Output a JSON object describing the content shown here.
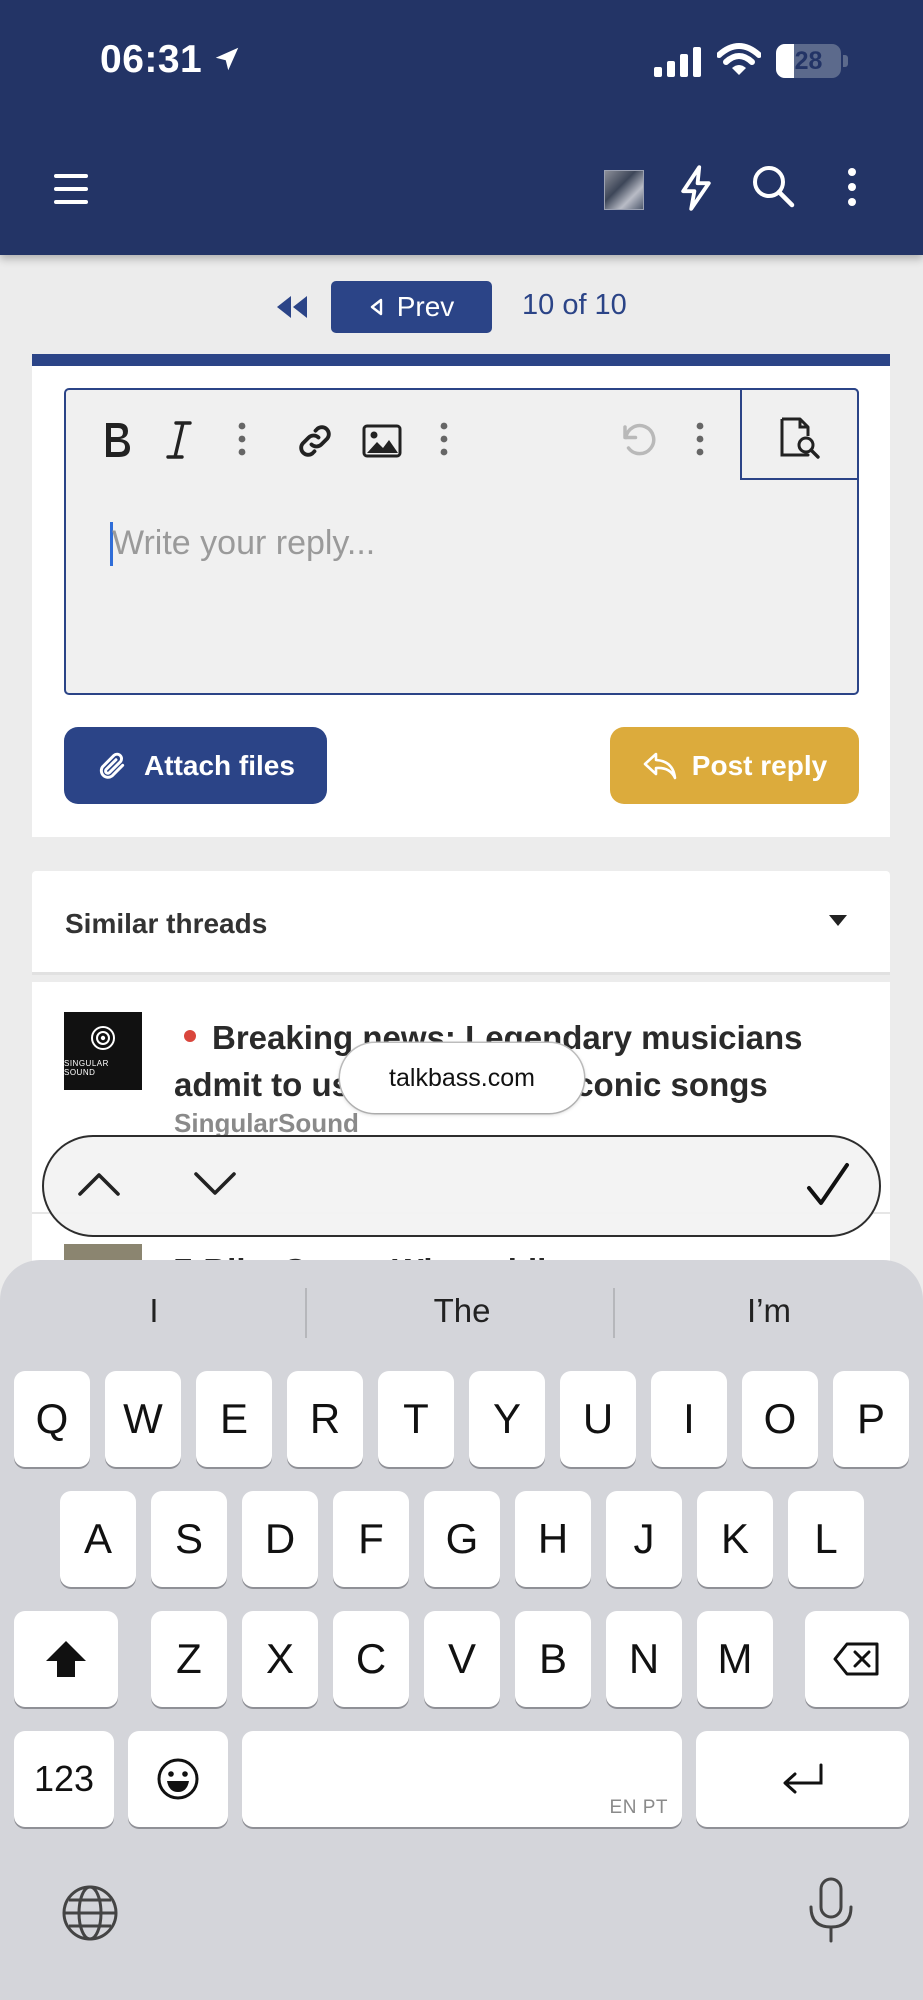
{
  "status_bar": {
    "time": "06:31",
    "battery": "28",
    "battery_level": 0.28,
    "icons": [
      "location-arrow-icon",
      "signal-bars-icon",
      "wifi-icon",
      "battery-icon"
    ]
  },
  "header": {
    "icons": [
      "hamburger-menu-icon",
      "avatar",
      "bolt-icon",
      "search-icon",
      "more-vertical-icon"
    ]
  },
  "pagination": {
    "first_icon": "double-chevron-left-icon",
    "prev_label": "Prev",
    "page_info": "10 of 10"
  },
  "editor": {
    "toolbar": [
      "bold-icon",
      "italic-icon",
      "more-vertical-icon",
      "link-icon",
      "image-icon",
      "more-vertical-icon",
      "undo-icon",
      "more-vertical-icon",
      "preview-icon"
    ],
    "placeholder": "Write your reply...",
    "value": ""
  },
  "actions": {
    "attach_label": "Attach files",
    "post_label": "Post reply"
  },
  "similar_threads": {
    "title": "Similar threads",
    "items": [
      {
        "title": "Breaking news: Legendary musicians admit to us",
        "title_tail": "y in iconic songs",
        "author": "SingularSound",
        "logo_text": "SINGULAR SOUND"
      },
      {
        "title": "7-Bike Gear... Why ... bike ...",
        "author": ""
      }
    ]
  },
  "url_pill": "talkbass.com",
  "accessory": {
    "icons": [
      "chevron-up-icon",
      "chevron-down-icon",
      "checkmark-icon"
    ]
  },
  "keyboard": {
    "suggestions": [
      "I",
      "The",
      "I’m"
    ],
    "row1": [
      "Q",
      "W",
      "E",
      "R",
      "T",
      "Y",
      "U",
      "I",
      "O",
      "P"
    ],
    "row2": [
      "A",
      "S",
      "D",
      "F",
      "G",
      "H",
      "J",
      "K",
      "L"
    ],
    "row3": [
      "Z",
      "X",
      "C",
      "V",
      "B",
      "N",
      "M"
    ],
    "numbers_key": "123",
    "space_hint": "EN PT",
    "colors": {
      "key_bg": "#ffffff",
      "keyboard_bg": "#d4d5da"
    }
  },
  "colors": {
    "header_bg": "#233466",
    "primary": "#2b4487",
    "accent": "#dcab3c",
    "prefix_dot": "#d9463c"
  }
}
